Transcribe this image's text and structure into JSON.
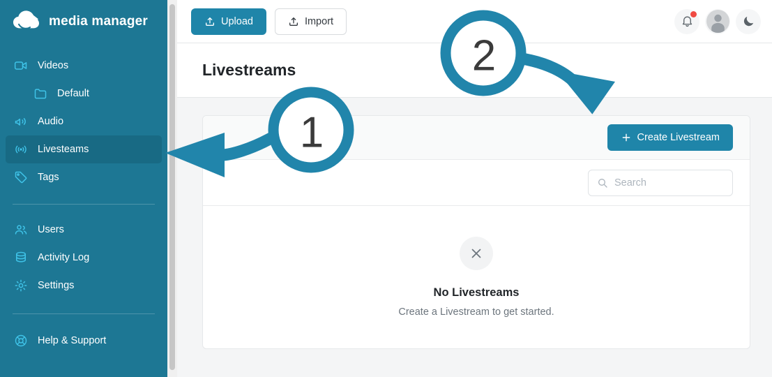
{
  "brand": {
    "name": "media manager",
    "logo_icon": "cloud-upload-logo"
  },
  "sidebar": {
    "items": [
      {
        "label": "Videos",
        "icon": "video-camera-icon",
        "active": false,
        "sub": false
      },
      {
        "label": "Default",
        "icon": "folder-icon",
        "active": false,
        "sub": true
      },
      {
        "label": "Audio",
        "icon": "speaker-icon",
        "active": false,
        "sub": false
      },
      {
        "label": "Livesteams",
        "icon": "broadcast-icon",
        "active": true,
        "sub": false
      },
      {
        "label": "Tags",
        "icon": "tag-icon",
        "active": false,
        "sub": false
      },
      {
        "label": "Users",
        "icon": "users-icon",
        "active": false,
        "sub": false
      },
      {
        "label": "Activity Log",
        "icon": "database-icon",
        "active": false,
        "sub": false
      },
      {
        "label": "Settings",
        "icon": "gear-icon",
        "active": false,
        "sub": false
      },
      {
        "label": "Help & Support",
        "icon": "lifebuoy-icon",
        "active": false,
        "sub": false
      }
    ]
  },
  "topbar": {
    "upload_label": "Upload",
    "upload_icon": "upload-icon",
    "import_label": "Import",
    "import_icon": "upload-icon",
    "notifications_icon": "bell-icon",
    "notifications_has_badge": true,
    "avatar_icon": "user-avatar-icon",
    "theme_toggle_icon": "moon-icon"
  },
  "page": {
    "title": "Livestreams"
  },
  "card": {
    "create_label": "Create Livestream",
    "create_icon": "plus-icon",
    "search_placeholder": "Search",
    "search_value": "",
    "search_icon": "search-icon",
    "empty_icon": "x-close-icon",
    "empty_title": "No Livestreams",
    "empty_subtitle": "Create a Livestream to get started."
  },
  "annotations": [
    {
      "number": "1",
      "target": "sidebar-item-livesteams"
    },
    {
      "number": "2",
      "target": "create-livestream-button"
    }
  ],
  "colors": {
    "sidebar_bg": "#1d7794",
    "sidebar_active_bg": "#186a84",
    "sidebar_icon": "#3fc3e8",
    "accent": "#1f85a9",
    "annotation": "#2185ab",
    "badge": "#f04a42",
    "page_bg": "#f4f5f6"
  }
}
